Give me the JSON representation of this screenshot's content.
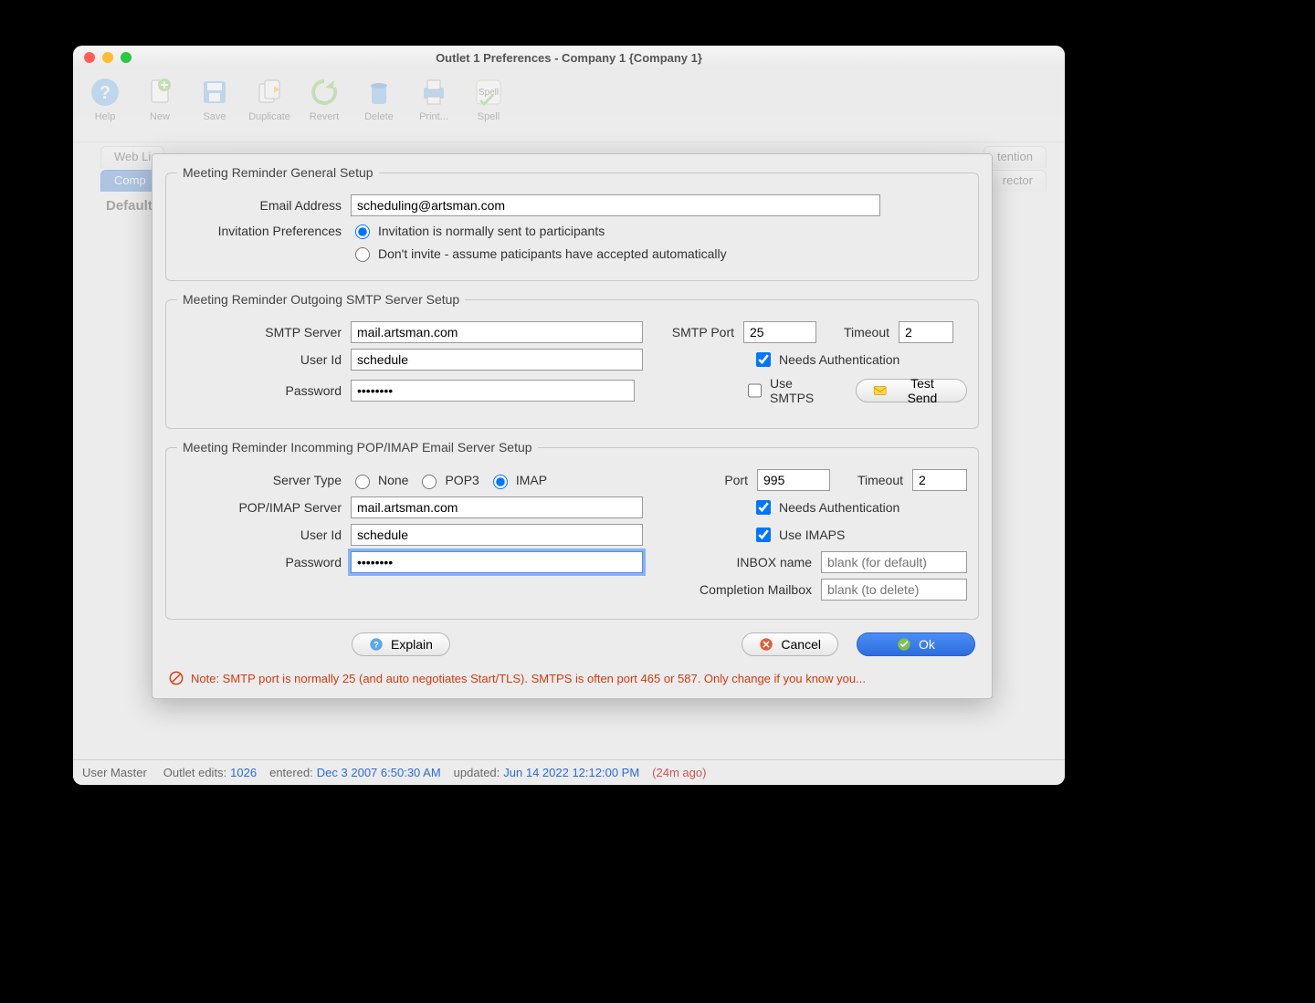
{
  "window": {
    "title": "Outlet 1 Preferences - Company 1 {Company 1}"
  },
  "toolbar": [
    {
      "label": "Help",
      "icon": "help"
    },
    {
      "label": "New",
      "icon": "new"
    },
    {
      "label": "Save",
      "icon": "save"
    },
    {
      "label": "Duplicate",
      "icon": "dup"
    },
    {
      "label": "Revert",
      "icon": "revert"
    },
    {
      "label": "Delete",
      "icon": "delete"
    },
    {
      "label": "Print...",
      "icon": "print"
    },
    {
      "label": "Spell",
      "icon": "spell"
    }
  ],
  "tabs": {
    "left_partial": "Web Li",
    "selected": "Comp",
    "right_partial": "tention",
    "row2_label": "rector",
    "default_label": "Default"
  },
  "general": {
    "legend": "Meeting Reminder General Setup",
    "email_label": "Email Address",
    "email_value": "scheduling@artsman.com",
    "inv_label": "Invitation Preferences",
    "inv_opt1": "Invitation is normally sent to participants",
    "inv_opt2": "Don't invite - assume paticipants have accepted automatically"
  },
  "smtp": {
    "legend": "Meeting Reminder Outgoing SMTP Server Setup",
    "server_label": "SMTP Server",
    "server_value": "mail.artsman.com",
    "port_label": "SMTP Port",
    "port_value": "25",
    "timeout_label": "Timeout",
    "timeout_value": "2",
    "user_label": "User Id",
    "user_value": "schedule",
    "pwd_label": "Password",
    "pwd_value": "********",
    "needs_auth_label": "Needs Authentication",
    "use_smtps_label": "Use SMTPS",
    "test_send_label": "Test Send"
  },
  "incoming": {
    "legend": "Meeting Reminder Incomming POP/IMAP Email Server Setup",
    "type_label": "Server Type",
    "type_none": "None",
    "type_pop3": "POP3",
    "type_imap": "IMAP",
    "port_label": "Port",
    "port_value": "995",
    "timeout_label": "Timeout",
    "timeout_value": "2",
    "server_label": "POP/IMAP Server",
    "server_value": "mail.artsman.com",
    "user_label": "User Id",
    "user_value": "schedule",
    "pwd_label": "Password",
    "pwd_value": "********",
    "needs_auth_label": "Needs Authentication",
    "use_imaps_label": "Use IMAPS",
    "inbox_label": "INBOX name",
    "inbox_ph": "blank (for default)",
    "inbox_value": "",
    "completion_label": "Completion Mailbox",
    "completion_ph": "blank (to delete)",
    "completion_value": ""
  },
  "footer": {
    "explain": "Explain",
    "cancel": "Cancel",
    "ok": "Ok",
    "note": "Note: SMTP port is normally 25 (and auto negotiates Start/TLS).  SMTPS is often port 465 or 587.  Only change if you know you..."
  },
  "status": {
    "user_label": "User Master",
    "edits_label": "Outlet edits: ",
    "edits_v": "1026",
    "entered_label": "entered: ",
    "entered_v": "Dec 3 2007 6:50:30 AM",
    "updated_label": "updated: ",
    "updated_v": "Jun 14 2022 12:12:00 PM",
    "ago": "(24m ago)"
  }
}
